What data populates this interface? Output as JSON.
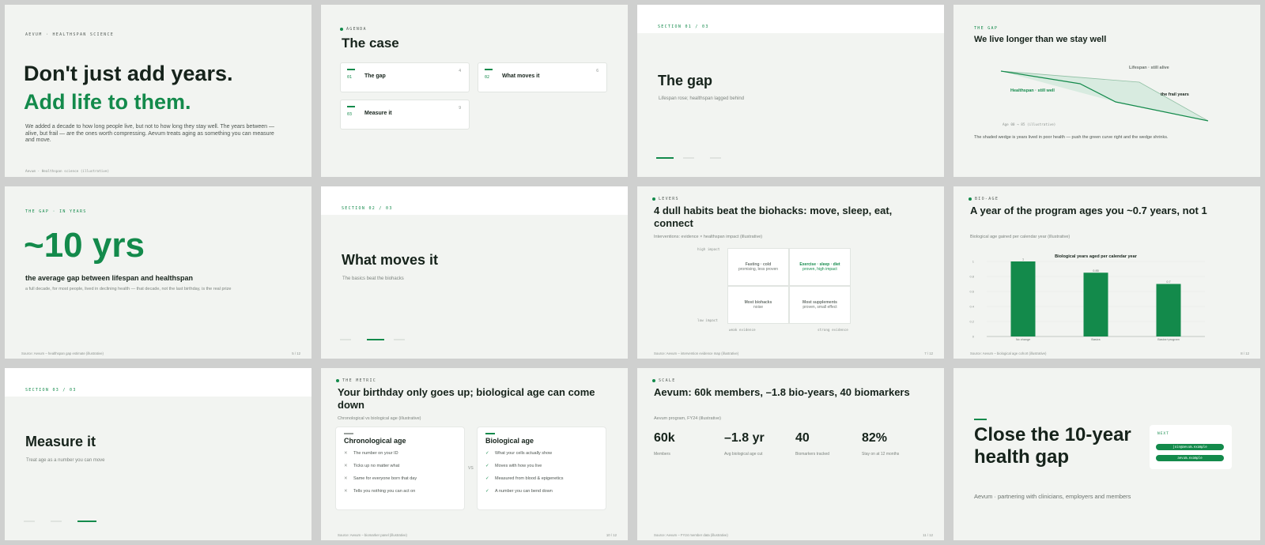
{
  "s1": {
    "kicker": "AEVUM · HEALTHSPAN SCIENCE",
    "title_line1": "Don't just add years.",
    "title_line2": "Add life to them.",
    "body": "We added a decade to how long people live, but not to how long they stay well. The years between — alive, but frail — are the ones worth compressing. Aevum treats aging as something you can measure and move.",
    "footer": "Aevum · Healthspan science (illustrative)"
  },
  "s2": {
    "kicker": "AGENDA",
    "title": "The case",
    "items": [
      {
        "num": "01",
        "label": "The gap",
        "page": "4"
      },
      {
        "num": "02",
        "label": "What moves it",
        "page": "6"
      },
      {
        "num": "03",
        "label": "Measure it",
        "page": "9"
      }
    ]
  },
  "s3": {
    "kicker": "SECTION 01 / 03",
    "title": "The gap",
    "sub": "Lifespan rose; healthspan lagged behind"
  },
  "s4": {
    "kicker": "THE GAP",
    "title": "We live longer than we stay well",
    "label_lifespan": "Lifespan · still alive",
    "label_healthspan": "Healthspan · still well",
    "label_frail": "the frail years",
    "axis_note": "Age 00 → 85 (illustrative)",
    "caption": "The shaded wedge is years lived in poor health — push the green curve right and the wedge shrinks."
  },
  "s5": {
    "kicker": "THE GAP · IN YEARS",
    "big": "~10 yrs",
    "headline": "the average gap between lifespan and healthspan",
    "sub": "a full decade, for most people, lived in declining health — that decade, not the last birthday, is the real prize",
    "footer": "Source: Aevum – healthspan gap estimate (illustrative)",
    "page": "5 / 12"
  },
  "s6": {
    "kicker": "SECTION 02 / 03",
    "title": "What moves it",
    "sub": "The basics beat the biohacks"
  },
  "s7": {
    "kicker": "LEVERS",
    "title": "4 dull habits beat the biohacks: move, sleep, eat, connect",
    "sub": "Interventions: evidence × healthspan impact (illustrative)",
    "y_high": "high impact",
    "y_low": "low impact",
    "x_weak": "weak evidence",
    "x_strong": "strong evidence",
    "q_tl_title": "Fasting · cold",
    "q_tl_sub": "promising, less proven",
    "q_tr_title": "Exercise · sleep · diet",
    "q_tr_sub": "proven, high impact",
    "q_bl_title": "Most biohacks",
    "q_bl_sub": "noise",
    "q_br_title": "Most supplements",
    "q_br_sub": "proven, small effect",
    "footer": "Source: Aevum – intervention evidence map (illustrative)",
    "page": "7 / 12"
  },
  "s8": {
    "kicker": "BIO-AGE",
    "title": "A year of the program ages you ~0.7 years, not 1",
    "sub": "Biological age gained per calendar year (illustrative)",
    "footer": "Source: Aevum – biological age cohort (illustrative)",
    "page": "8 / 12"
  },
  "chart_data": {
    "type": "bar",
    "title": "Biological years aged per calendar year",
    "categories": [
      "No change",
      "Basics",
      "Basics+program"
    ],
    "values": [
      1,
      0.85,
      0.7
    ],
    "value_labels": [
      "1",
      "0.85",
      "0.7"
    ],
    "yticks": [
      "0",
      "0.2",
      "0.4",
      "0.6",
      "0.8",
      "1"
    ],
    "ylim": [
      0,
      1
    ],
    "color": "#138a4b",
    "grid": true
  },
  "s9": {
    "kicker": "SECTION 03 / 03",
    "title": "Measure it",
    "sub": "Treat age as a number you can move"
  },
  "s10": {
    "kicker": "THE METRIC",
    "title": "Your birthday only goes up; biological age can come down",
    "sub": "Chronological vs biological age (illustrative)",
    "vs": "VS",
    "left_title": "Chronological age",
    "left_items": [
      "The number on your ID",
      "Ticks up no matter what",
      "Same for everyone born that day",
      "Tells you nothing you can act on"
    ],
    "right_title": "Biological age",
    "right_items": [
      "What your cells actually show",
      "Moves with how you live",
      "Measured from blood & epigenetics",
      "A number you can bend down"
    ],
    "footer": "Source: Aevum – biomarker panel (illustrative)",
    "page": "10 / 12"
  },
  "s11": {
    "kicker": "SCALE",
    "title": "Aevum: 60k members, –1.8 bio-years, 40 biomarkers",
    "sub": "Aevum program, FY24 (illustrative)",
    "stats": [
      {
        "value": "60k",
        "label": "Members"
      },
      {
        "value": "–1.8 yr",
        "label": "Avg biological age cut"
      },
      {
        "value": "40",
        "label": "Biomarkers tracked"
      },
      {
        "value": "82%",
        "label": "Stay on at 12 months"
      }
    ],
    "footer": "Source: Aevum – FY24 member data (illustrative)",
    "page": "11 / 12"
  },
  "s12": {
    "title_line1": "Close the 10-year",
    "title_line2": "health gap",
    "sub": "Aevum · partnering with clinicians, employers and members",
    "next_label": "NEXT",
    "cta1": "join@aevum.example",
    "cta2": "aevum.example"
  }
}
